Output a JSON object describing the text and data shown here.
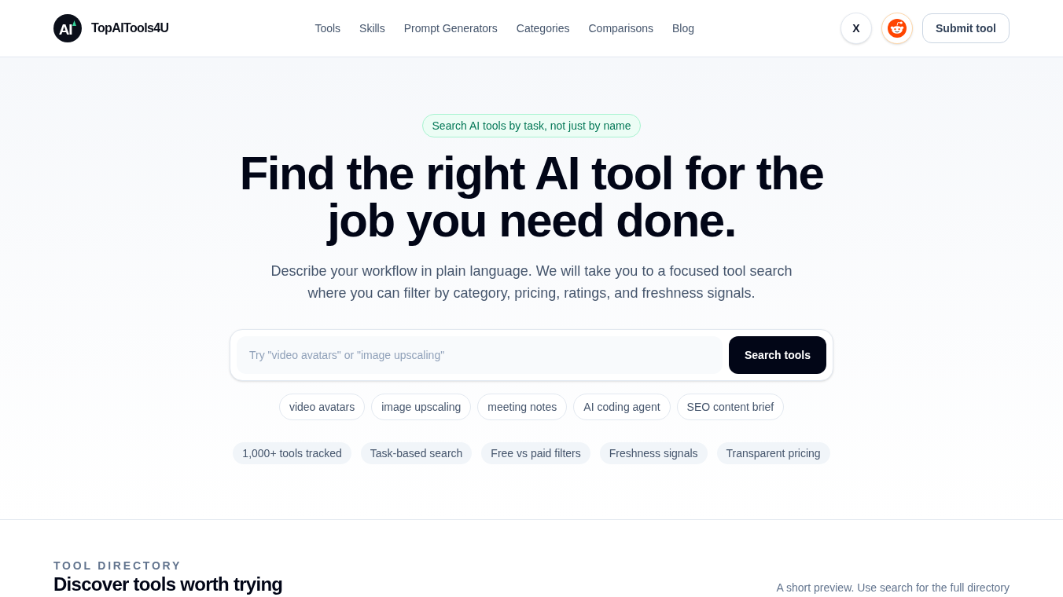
{
  "header": {
    "logo": {
      "mark": "AI",
      "name": "TopAITools4U"
    },
    "nav": [
      "Tools",
      "Skills",
      "Prompt Generators",
      "Categories",
      "Comparisons",
      "Blog"
    ],
    "social_links": [
      {
        "kind": "text",
        "label": "X"
      },
      {
        "kind": "icon"
      }
    ],
    "submit_button": "Submit tool"
  },
  "hero": {
    "badge": "Search AI tools by task, not just by name",
    "title": "Find the right AI tool for the job you need done.",
    "description": "Describe your workflow in plain language. We will take you to a focused tool search where you can filter by category, pricing, ratings, and freshness signals.",
    "search": {
      "placeholder": "Try \"video avatars\" or \"image upscaling\"",
      "button": "Search tools"
    },
    "suggestions": [
      "video avatars",
      "image upscaling",
      "meeting notes",
      "AI coding agent",
      "SEO content brief"
    ],
    "highlights": [
      "1,000+ tools tracked",
      "Task-based search",
      "Free vs paid filters",
      "Freshness signals",
      "Transparent pricing"
    ]
  },
  "directory": {
    "eyebrow": "TOOL DIRECTORY",
    "title": "Discover tools worth trying",
    "note": "A short preview. Use search for the full directory"
  }
}
